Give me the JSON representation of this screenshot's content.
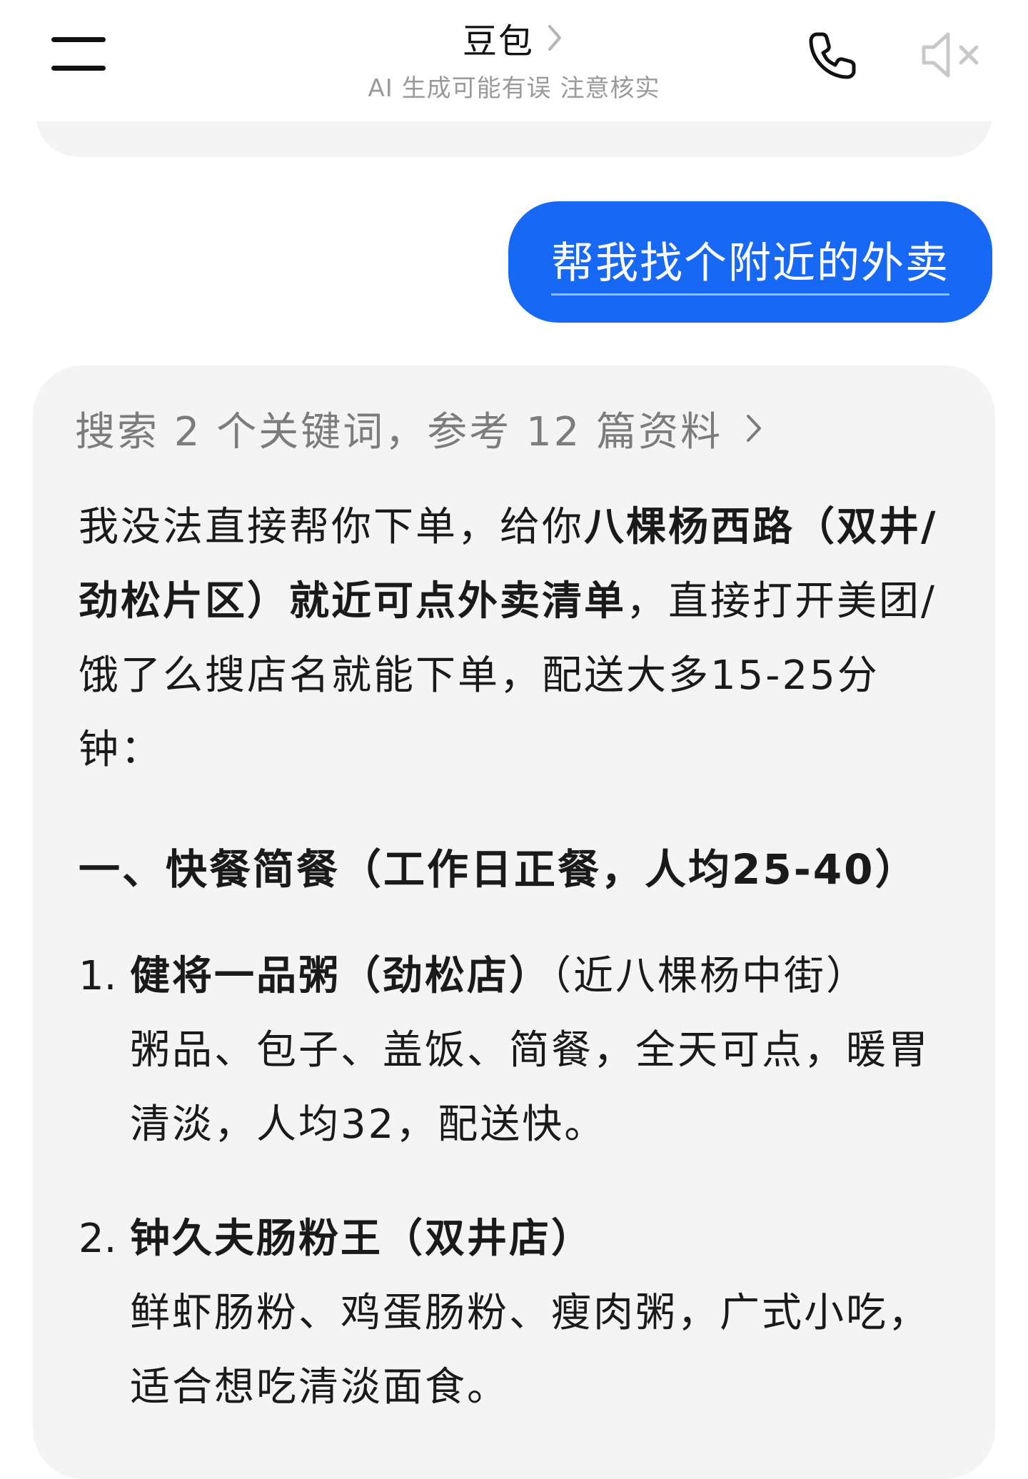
{
  "header": {
    "title": "豆包",
    "subtitle": "AI 生成可能有误 注意核实",
    "icons": {
      "menu": "menu-icon",
      "phone": "phone-icon",
      "mute": "speaker-muted-icon",
      "title_chevron": "chevron-right-icon"
    }
  },
  "colors": {
    "user_bubble": "#1668f5",
    "card_bg": "#f4f4f5",
    "muted_text": "#9a9a9a"
  },
  "user_message": {
    "text": "帮我找个附近的外卖"
  },
  "answer": {
    "refs_text": "搜索 2 个关键词，参考 12 篇资料",
    "intro": {
      "part1": "我没法直接帮你下单，给你",
      "bold": "八棵杨西路（双井/劲松片区）就近可点外卖清单",
      "part2": "，直接打开美团/饿了么搜店名就能下单，配送大多15-25分钟："
    },
    "section_heading": "一、快餐简餐（工作日正餐，人均25-40）",
    "items": [
      {
        "num": "1.",
        "title": "健将一品粥（劲松店）",
        "note": "（近八棵杨中街）",
        "desc": "粥品、包子、盖饭、简餐，全天可点，暖胃清淡，人均32，配送快。"
      },
      {
        "num": "2.",
        "title": "钟久夫肠粉王（双井店）",
        "note": "",
        "desc": "鲜虾肠粉、鸡蛋肠粉、瘦肉粥，广式小吃，适合想吃清淡面食。"
      }
    ]
  }
}
